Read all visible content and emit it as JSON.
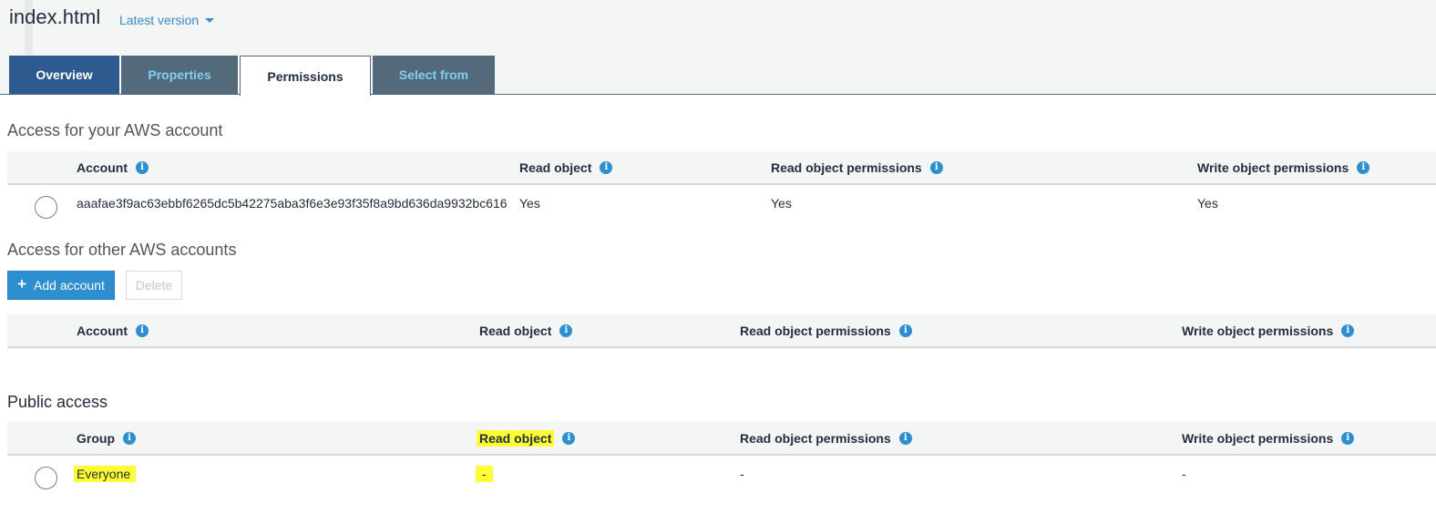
{
  "header": {
    "title": "index.html",
    "version_label": "Latest version"
  },
  "tabs": {
    "overview": "Overview",
    "properties": "Properties",
    "permissions": "Permissions",
    "select_from": "Select from"
  },
  "own_account": {
    "title": "Access for your AWS account",
    "columns": [
      "Account",
      "Read object",
      "Read object permissions",
      "Write object permissions"
    ],
    "row": {
      "account": "aaafae3f9ac63ebbf6265dc5b42275aba3f6e3e93f35f8a9bd636da9932bc616",
      "read_object": "Yes",
      "read_object_permissions": "Yes",
      "write_object_permissions": "Yes"
    }
  },
  "other_accounts": {
    "title": "Access for other AWS accounts",
    "add_label": "Add account",
    "delete_label": "Delete",
    "columns": [
      "Account",
      "Read object",
      "Read object permissions",
      "Write object permissions"
    ]
  },
  "public_access": {
    "title": "Public access",
    "columns": [
      "Group",
      "Read object",
      "Read object permissions",
      "Write object permissions"
    ],
    "row": {
      "group": "Everyone",
      "read_object": "-",
      "read_object_permissions": "-",
      "write_object_permissions": "-"
    }
  },
  "colors": {
    "tab_active_dark": "#2e5b8f",
    "tab_inactive": "#546979",
    "tab_inactive_text": "#7fd0f5",
    "primary_button": "#2e8fd0",
    "highlight": "#ffff33"
  },
  "icons": {
    "info": "info-circle-icon",
    "add": "plus-icon",
    "version_dropdown": "caret-down-icon"
  }
}
